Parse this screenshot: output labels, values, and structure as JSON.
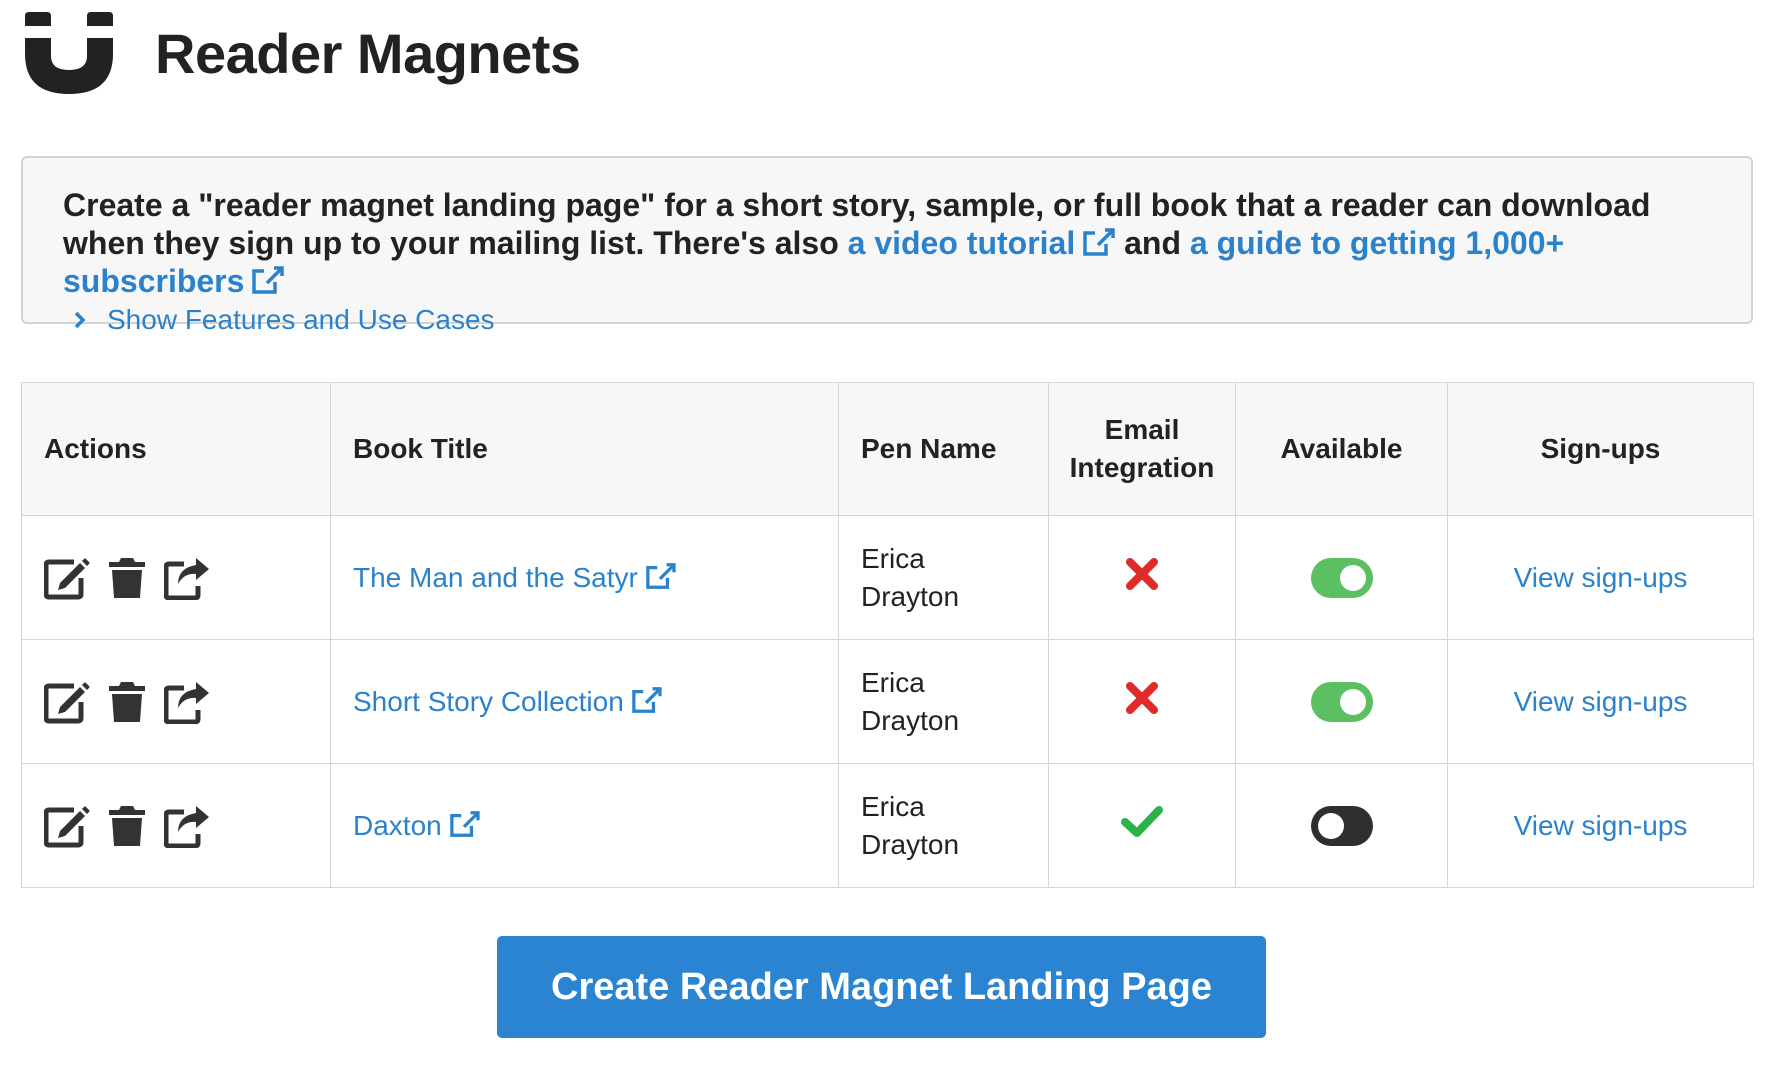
{
  "header": {
    "title": "Reader Magnets",
    "logo_icon": "magnet-icon"
  },
  "info": {
    "text_intro": "Create a \"reader magnet landing page\" for a short story, sample, or full book that a reader can download when they sign up to your mailing list. There's also ",
    "video_link": "a video tutorial",
    "and_text": " and ",
    "guide_link": "a guide to getting 1,000+ subscribers",
    "features_link": "Show Features and Use Cases"
  },
  "table": {
    "headers": {
      "actions": "Actions",
      "book_title": "Book Title",
      "pen_name": "Pen Name",
      "email_integration_1": "Email",
      "email_integration_2": "Integration",
      "available": "Available",
      "signups": "Sign-ups"
    },
    "rows": [
      {
        "title": "The Man and the Satyr",
        "pen_first": "Erica",
        "pen_last": "Drayton",
        "email_integration": false,
        "available": true,
        "signups_label": "View sign-ups"
      },
      {
        "title": "Short Story Collection",
        "pen_first": "Erica",
        "pen_last": "Drayton",
        "email_integration": false,
        "available": true,
        "signups_label": "View sign-ups"
      },
      {
        "title": "Daxton",
        "pen_first": "Erica",
        "pen_last": "Drayton",
        "email_integration": true,
        "available": false,
        "signups_label": "View sign-ups"
      }
    ]
  },
  "create_button": "Create Reader Magnet Landing Page",
  "colors": {
    "link": "#2b82cc",
    "button": "#2a84d2",
    "toggle_on": "#5cbf62",
    "toggle_off": "#2f2f2f",
    "cross": "#e02a2a",
    "check": "#2bb24c"
  }
}
